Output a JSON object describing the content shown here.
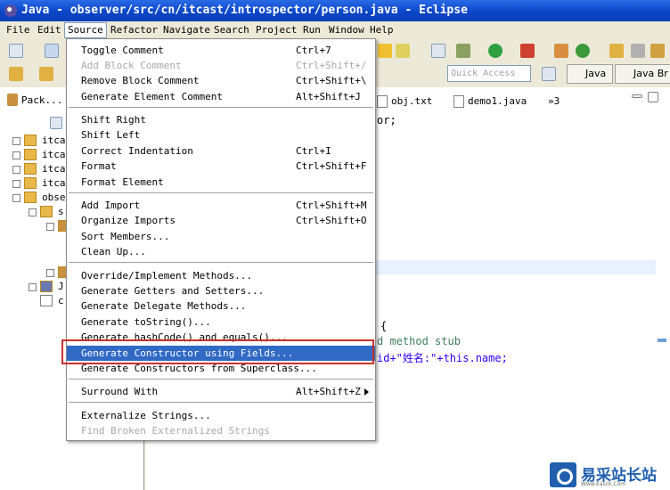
{
  "window": {
    "title": "Java - observer/src/cn/itcast/introspector/person.java - Eclipse"
  },
  "menubar": {
    "file": "File",
    "edit": "Edit",
    "source": "Source",
    "refactor": "Refactor",
    "navigate": "Navigate",
    "search": "Search",
    "project": "Project",
    "run": "Run",
    "window": "Window",
    "help": "Help"
  },
  "toolbar": {
    "quick_access_placeholder": "Quick Access",
    "perspective_java": "Java",
    "perspective_java_browsing": "Java Br"
  },
  "package_explorer": {
    "tab_label": "Pack...",
    "items": [
      "itca",
      "itca",
      "itca",
      "itca",
      "obse",
      "s",
      "",
      "",
      "",
      "J",
      "c"
    ]
  },
  "editor": {
    "tabs": [
      "obj.txt",
      "demo1.java",
      "»3"
    ],
    "code": [
      "or;",
      "{",
      "d method stub",
      "id+\"姓名:\"+this.name;"
    ]
  },
  "source_menu": {
    "toggle_comment": "Toggle Comment",
    "toggle_comment_key": "Ctrl+7",
    "add_block_comment": "Add Block Comment",
    "add_block_comment_key": "Ctrl+Shift+/",
    "remove_block_comment": "Remove Block Comment",
    "remove_block_comment_key": "Ctrl+Shift+\\",
    "generate_element_comment": "Generate Element Comment",
    "generate_element_comment_key": "Alt+Shift+J",
    "shift_right": "Shift Right",
    "shift_left": "Shift Left",
    "correct_indentation": "Correct Indentation",
    "correct_indentation_key": "Ctrl+I",
    "format": "Format",
    "format_key": "Ctrl+Shift+F",
    "format_element": "Format Element",
    "add_import": "Add Import",
    "add_import_key": "Ctrl+Shift+M",
    "organize_imports": "Organize Imports",
    "organize_imports_key": "Ctrl+Shift+O",
    "sort_members": "Sort Members...",
    "clean_up": "Clean Up...",
    "override_implement": "Override/Implement Methods...",
    "generate_getters_setters": "Generate Getters and Setters...",
    "generate_delegate": "Generate Delegate Methods...",
    "generate_tostring": "Generate toString()...",
    "generate_hashcode_equals": "Generate hashCode() and equals()...",
    "generate_constructor_fields": "Generate Constructor using Fields...",
    "generate_constructors_superclass": "Generate Constructors from Superclass...",
    "surround_with": "Surround With",
    "surround_with_key": "Alt+Shift+Z",
    "externalize_strings": "Externalize Strings...",
    "find_broken_externalized": "Find Broken Externalized Strings"
  },
  "watermark": {
    "text": "易采站长站",
    "sub": "Www.Easck.Com"
  },
  "colors": {
    "title_bar": "#0a46c8",
    "selection": "#316ac5",
    "highlight_border": "#c8322d",
    "watermark_blue": "#1f5fae"
  }
}
